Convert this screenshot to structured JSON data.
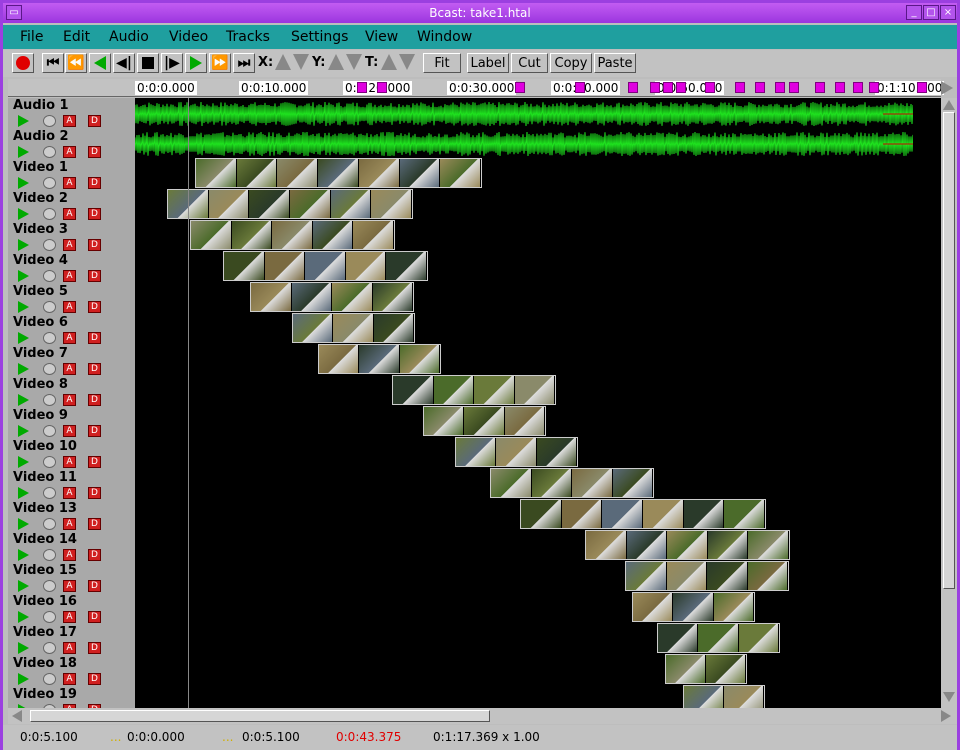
{
  "window": {
    "title": "Bcast: take1.htal"
  },
  "menu": [
    "File",
    "Edit",
    "Audio",
    "Video",
    "Tracks",
    "Settings",
    "View",
    "Window"
  ],
  "toolbar": {
    "x_label": "X:",
    "y_label": "Y:",
    "t_label": "T:",
    "fit": "Fit",
    "label": "Label",
    "cut": "Cut",
    "copy": "Copy",
    "paste": "Paste"
  },
  "ruler": [
    "0:0:0.000",
    "0:0:10.000",
    "0:0:20.000",
    "0:0:30.000",
    "0:0:40.000",
    "0:0:50.000",
    "0:1:10.000"
  ],
  "tracks": [
    {
      "name": "Audio 1"
    },
    {
      "name": "Audio 2"
    },
    {
      "name": "Video 1"
    },
    {
      "name": "Video 2"
    },
    {
      "name": "Video 3"
    },
    {
      "name": "Video 4"
    },
    {
      "name": "Video 5"
    },
    {
      "name": "Video 6"
    },
    {
      "name": "Video 7"
    },
    {
      "name": "Video 8"
    },
    {
      "name": "Video 9"
    },
    {
      "name": "Video 10"
    },
    {
      "name": "Video 11"
    },
    {
      "name": "Video 13"
    },
    {
      "name": "Video 14"
    },
    {
      "name": "Video 15"
    },
    {
      "name": "Video 16"
    },
    {
      "name": "Video 17"
    },
    {
      "name": "Video 18"
    },
    {
      "name": "Video 19"
    }
  ],
  "status": {
    "selection_start": "0:0:5.100",
    "start_dots": "...",
    "region_start": "0:0:0.000",
    "end_dots": "...",
    "region_end": "0:0:5.100",
    "position": "0:0:43.375",
    "total_zoom": "0:1:17.369 x 1.00"
  },
  "colors": {
    "title_bar": "#9b35df",
    "menu_bar": "#1f9f9f",
    "waveform": "#1ee11e",
    "marker": "#e000e0",
    "position": "#e00000"
  }
}
